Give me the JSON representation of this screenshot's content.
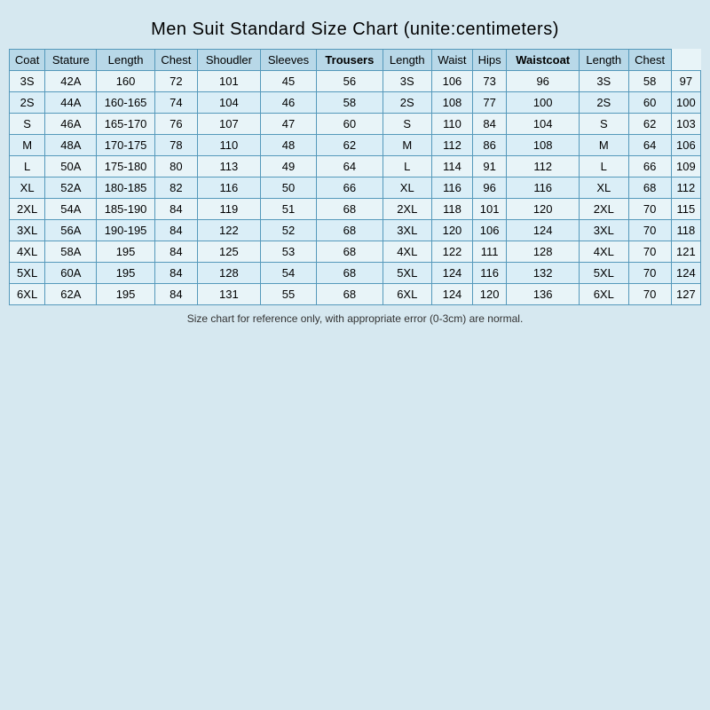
{
  "title": "Men Suit Standard Size Chart   (unite:centimeters)",
  "headers": [
    {
      "label": "Coat",
      "bold": false
    },
    {
      "label": "Stature",
      "bold": false
    },
    {
      "label": "Length",
      "bold": false
    },
    {
      "label": "Chest",
      "bold": false
    },
    {
      "label": "Shoudler",
      "bold": false
    },
    {
      "label": "Sleeves",
      "bold": false
    },
    {
      "label": "Trousers",
      "bold": true
    },
    {
      "label": "Length",
      "bold": false
    },
    {
      "label": "Waist",
      "bold": false
    },
    {
      "label": "Hips",
      "bold": false
    },
    {
      "label": "Waistcoat",
      "bold": true
    },
    {
      "label": "Length",
      "bold": false
    },
    {
      "label": "Chest",
      "bold": false
    }
  ],
  "rows": [
    [
      "3S",
      "42A",
      "160",
      "72",
      "101",
      "45",
      "56",
      "3S",
      "106",
      "73",
      "96",
      "3S",
      "58",
      "97"
    ],
    [
      "2S",
      "44A",
      "160-165",
      "74",
      "104",
      "46",
      "58",
      "2S",
      "108",
      "77",
      "100",
      "2S",
      "60",
      "100"
    ],
    [
      "S",
      "46A",
      "165-170",
      "76",
      "107",
      "47",
      "60",
      "S",
      "110",
      "84",
      "104",
      "S",
      "62",
      "103"
    ],
    [
      "M",
      "48A",
      "170-175",
      "78",
      "110",
      "48",
      "62",
      "M",
      "112",
      "86",
      "108",
      "M",
      "64",
      "106"
    ],
    [
      "L",
      "50A",
      "175-180",
      "80",
      "113",
      "49",
      "64",
      "L",
      "114",
      "91",
      "112",
      "L",
      "66",
      "109"
    ],
    [
      "XL",
      "52A",
      "180-185",
      "82",
      "116",
      "50",
      "66",
      "XL",
      "116",
      "96",
      "116",
      "XL",
      "68",
      "112"
    ],
    [
      "2XL",
      "54A",
      "185-190",
      "84",
      "119",
      "51",
      "68",
      "2XL",
      "118",
      "101",
      "120",
      "2XL",
      "70",
      "115"
    ],
    [
      "3XL",
      "56A",
      "190-195",
      "84",
      "122",
      "52",
      "68",
      "3XL",
      "120",
      "106",
      "124",
      "3XL",
      "70",
      "118"
    ],
    [
      "4XL",
      "58A",
      "195",
      "84",
      "125",
      "53",
      "68",
      "4XL",
      "122",
      "111",
      "128",
      "4XL",
      "70",
      "121"
    ],
    [
      "5XL",
      "60A",
      "195",
      "84",
      "128",
      "54",
      "68",
      "5XL",
      "124",
      "116",
      "132",
      "5XL",
      "70",
      "124"
    ],
    [
      "6XL",
      "62A",
      "195",
      "84",
      "131",
      "55",
      "68",
      "6XL",
      "124",
      "120",
      "136",
      "6XL",
      "70",
      "127"
    ]
  ],
  "footnote": "Size chart for reference only, with appropriate error (0-3cm) are normal."
}
